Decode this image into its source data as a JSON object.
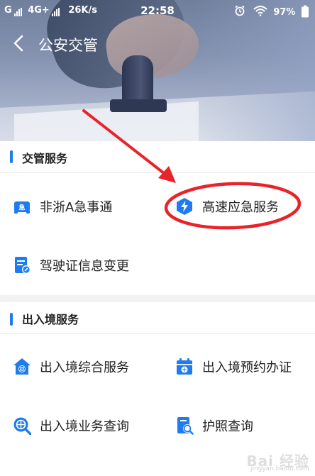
{
  "status_bar": {
    "carrier_left": "G",
    "network": "4G+",
    "speed": "26K/s",
    "time": "22:58",
    "battery": "97%"
  },
  "nav": {
    "title": "公安交管"
  },
  "sections": [
    {
      "title": "交管服务",
      "items": [
        {
          "label": "非浙A急事通",
          "icon": "car-icon"
        },
        {
          "label": "高速应急服务",
          "icon": "lightning-shield-icon"
        },
        {
          "label": "驾驶证信息变更",
          "icon": "document-edit-icon"
        }
      ]
    },
    {
      "title": "出入境服务",
      "items": [
        {
          "label": "出入境综合服务",
          "icon": "globe-house-icon"
        },
        {
          "label": "出入境预约办证",
          "icon": "calendar-icon"
        },
        {
          "label": "出入境业务查询",
          "icon": "globe-search-icon"
        },
        {
          "label": "护照查询",
          "icon": "passport-search-icon"
        }
      ]
    }
  ],
  "colors": {
    "accent": "#1f7cf0",
    "annotation": "#e8232a"
  },
  "watermark": {
    "text": "Bai 经验",
    "url": "jingyan.baidu.com"
  }
}
